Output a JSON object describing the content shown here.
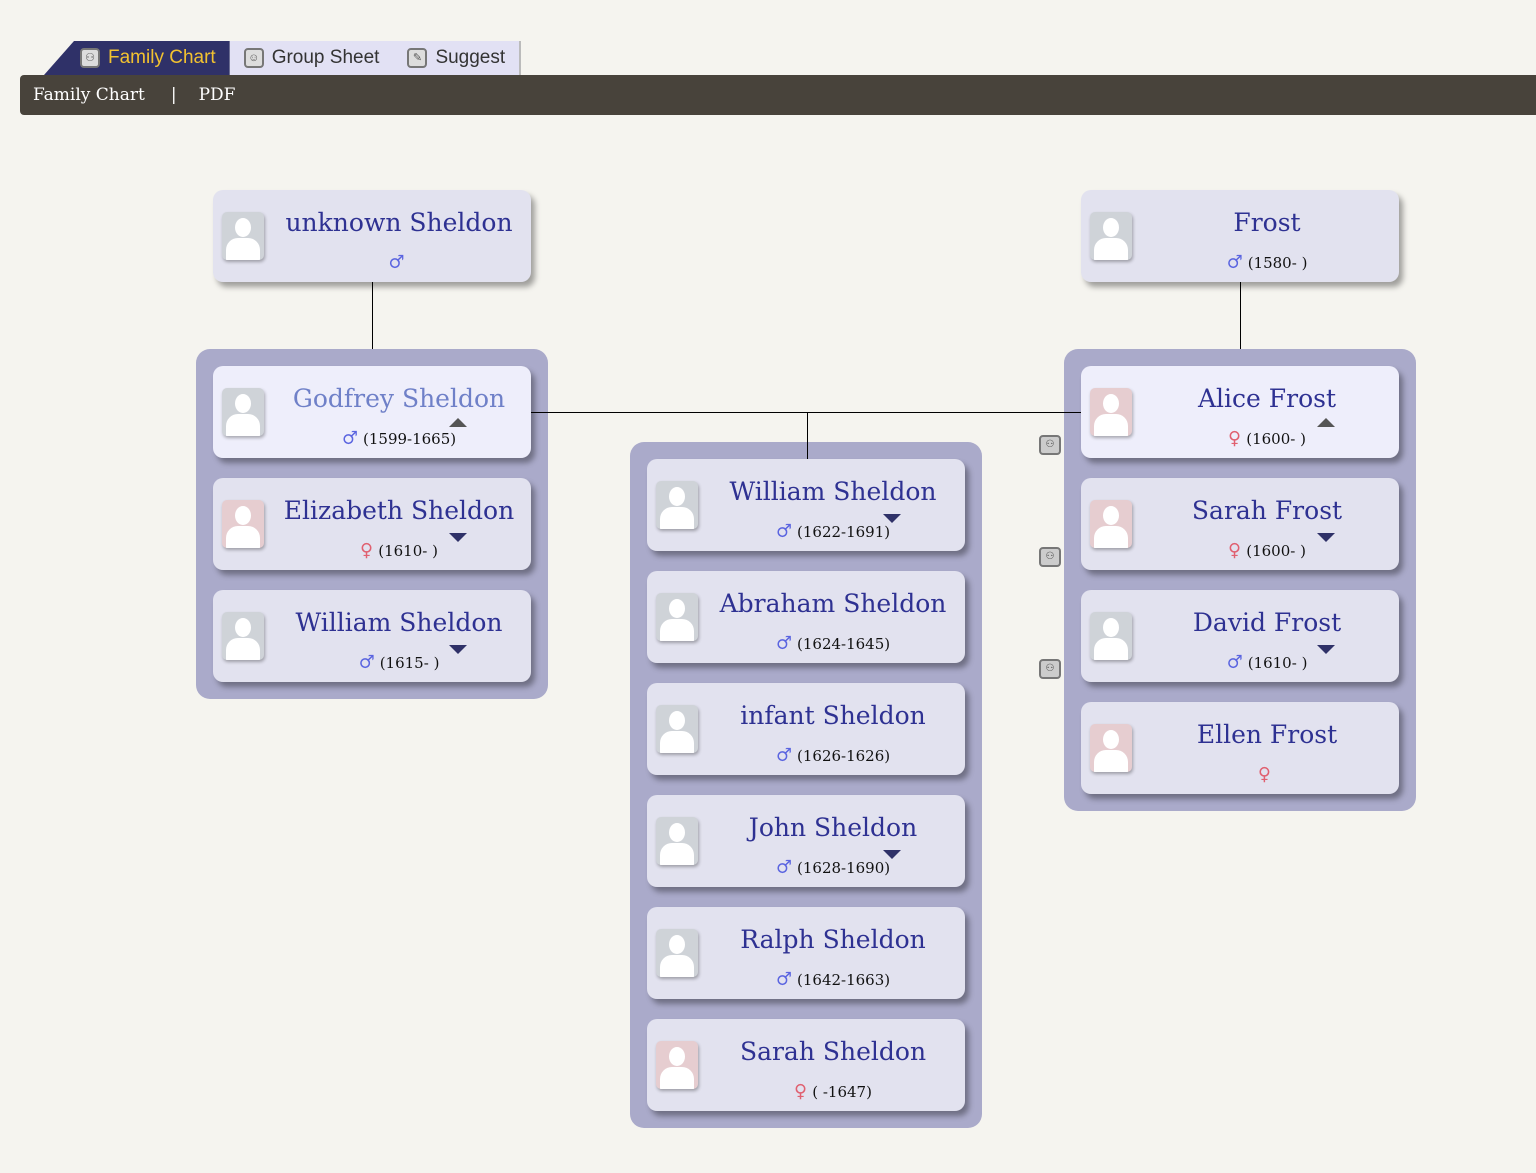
{
  "tabs": [
    {
      "label": "Family Chart",
      "icon": "family-chart-icon",
      "active": true
    },
    {
      "label": "Group Sheet",
      "icon": "group-sheet-icon"
    },
    {
      "label": "Suggest",
      "icon": "suggest-icon"
    }
  ],
  "toolbar": {
    "title": "Family Chart",
    "separator": "|",
    "pdf": "PDF"
  },
  "colors": {
    "tab_active_bg": "#2f3168",
    "tab_active_text": "#f2c230",
    "toolbar_bg": "#48433b",
    "group_bg": "#aaaaca",
    "name": "#2e3192",
    "male": "#5a64e0",
    "female": "#e06070"
  },
  "parents": [
    {
      "name": "unknown Sheldon",
      "sex": "male",
      "dates": ""
    },
    {
      "name": "Frost",
      "sex": "male",
      "dates": "(1580- )"
    }
  ],
  "left_family": [
    {
      "name": "Godfrey Sheldon",
      "sex": "male",
      "dates": "(1599-1665)",
      "arrow": "up",
      "focus": true
    },
    {
      "name": "Elizabeth Sheldon",
      "sex": "female",
      "dates": "(1610- )",
      "arrow": "down"
    },
    {
      "name": "William Sheldon",
      "sex": "male",
      "dates": "(1615- )",
      "arrow": "down"
    }
  ],
  "children": [
    {
      "name": "William Sheldon",
      "sex": "male",
      "dates": "(1622-1691)",
      "arrow": "down"
    },
    {
      "name": "Abraham Sheldon",
      "sex": "male",
      "dates": "(1624-1645)"
    },
    {
      "name": "infant Sheldon",
      "sex": "male",
      "dates": "(1626-1626)"
    },
    {
      "name": "John Sheldon",
      "sex": "male",
      "dates": "(1628-1690)",
      "arrow": "down"
    },
    {
      "name": "Ralph Sheldon",
      "sex": "male",
      "dates": "(1642-1663)"
    },
    {
      "name": "Sarah Sheldon",
      "sex": "female",
      "dates": "( -1647)"
    }
  ],
  "right_family": [
    {
      "name": "Alice Frost",
      "sex": "female",
      "dates": "(1600- )",
      "arrow": "up",
      "focus": true
    },
    {
      "name": "Sarah Frost",
      "sex": "female",
      "dates": "(1600- )",
      "arrow": "down"
    },
    {
      "name": "David Frost",
      "sex": "male",
      "dates": "(1610- )",
      "arrow": "down"
    },
    {
      "name": "Ellen Frost",
      "sex": "female",
      "dates": ""
    }
  ]
}
